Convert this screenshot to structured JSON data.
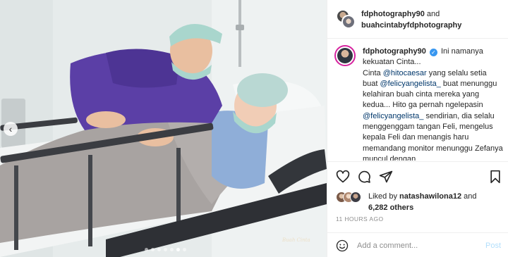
{
  "header": {
    "user1": "fdphotography90",
    "and_text": "and",
    "user2": "buahcintabyfdphotography"
  },
  "caption": {
    "username": "fdphotography90",
    "parts": {
      "p1": "Ini namanya kekuatan Cinta...",
      "p2": "Cinta ",
      "m1": "@hitocaesar",
      "p3": " yang selalu setia buat ",
      "m2": "@felicyangelista_",
      "p4": " buat menunggu kelahiran buah cinta mereka yang kedua... Hito ga pernah ngelepasin ",
      "m3": "@felicyangelista_",
      "p5": " sendirian, dia selalu menggenggam tangan Feli, mengelus kepala Feli dan menangis haru memandang monitor menunggu Zefanya muncul dengan"
    }
  },
  "likes": {
    "prefix": "Liked by ",
    "user": "natashawilona12",
    "middle": " and",
    "count": "6,282 others"
  },
  "timestamp": "11 HOURS AGO",
  "comment": {
    "placeholder": "Add a comment...",
    "post_label": "Post"
  },
  "photo": {
    "watermark": "Buah Cinta",
    "carousel_total": 7,
    "carousel_active": 6
  },
  "icons": {
    "prev": "chevron-left-icon",
    "like": "heart-icon",
    "comment": "comment-icon",
    "share": "paper-plane-icon",
    "save": "bookmark-icon",
    "emoji": "smiley-icon",
    "verified": "verified-badge-icon"
  },
  "colors": {
    "mention": "#00376b",
    "verified": "#3897f0",
    "post_disabled": "#b2dffc",
    "muted": "#8e8e8e"
  }
}
